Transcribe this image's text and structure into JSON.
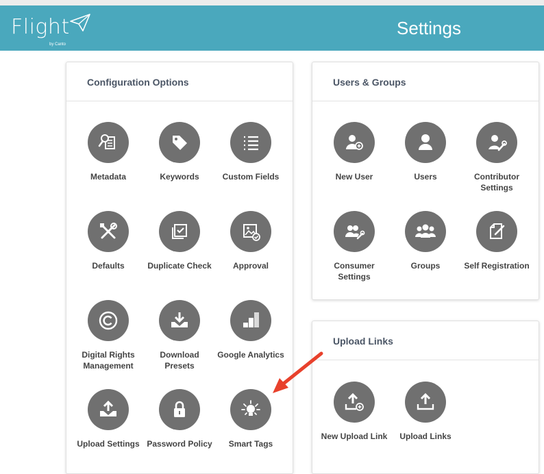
{
  "app": {
    "logo_text": "Flight",
    "logo_sub": "by Canto"
  },
  "header": {
    "title": "Settings"
  },
  "configuration": {
    "title": "Configuration Options",
    "tiles": [
      {
        "label": "Metadata",
        "icon": "metadata-icon"
      },
      {
        "label": "Keywords",
        "icon": "tag-icon"
      },
      {
        "label": "Custom Fields",
        "icon": "list-icon"
      },
      {
        "label": "Defaults",
        "icon": "tools-icon"
      },
      {
        "label": "Duplicate Check",
        "icon": "duplicate-check-icon"
      },
      {
        "label": "Approval",
        "icon": "image-check-icon"
      },
      {
        "label": "Digital Rights\nManagement",
        "icon": "copyright-icon"
      },
      {
        "label": "Download Presets",
        "icon": "download-tray-icon"
      },
      {
        "label": "Google Analytics",
        "icon": "analytics-icon"
      },
      {
        "label": "Upload Settings",
        "icon": "upload-tray-icon"
      },
      {
        "label": "Password Policy",
        "icon": "lock-icon"
      },
      {
        "label": "Smart Tags",
        "icon": "lightbulb-icon"
      }
    ]
  },
  "users_groups": {
    "title": "Users & Groups",
    "tiles": [
      {
        "label": "New User",
        "icon": "add-user-icon"
      },
      {
        "label": "Users",
        "icon": "user-icon"
      },
      {
        "label": "Contributor\nSettings",
        "icon": "user-wrench-icon"
      },
      {
        "label": "Consumer Settings",
        "icon": "users-wrench-icon"
      },
      {
        "label": "Groups",
        "icon": "group-icon"
      },
      {
        "label": "Self Registration",
        "icon": "edit-note-icon"
      }
    ]
  },
  "upload_links": {
    "title": "Upload Links",
    "tiles": [
      {
        "label": "New Upload Link",
        "icon": "upload-add-icon"
      },
      {
        "label": "Upload Links",
        "icon": "upload-icon"
      }
    ]
  },
  "colors": {
    "header": "#4aa8bd",
    "icon_circle": "#707070",
    "arrow": "#e8412c"
  }
}
